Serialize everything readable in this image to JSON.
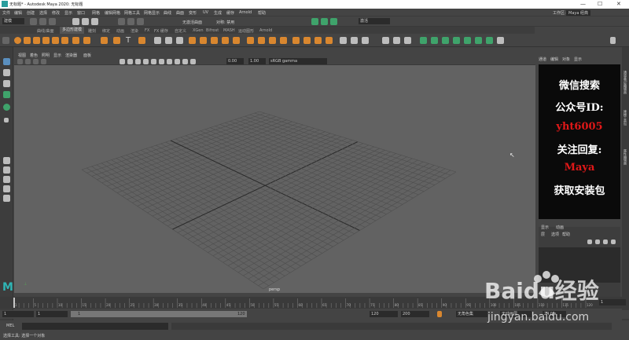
{
  "titlebar": {
    "title": "无标题* - Autodesk Maya 2020: 无标题",
    "minimize": "—",
    "maximize": "☐",
    "close": "✕"
  },
  "menubar": {
    "items": [
      "文件",
      "编辑",
      "创建",
      "选择",
      "修改",
      "显示",
      "窗口",
      "网格",
      "编辑网格",
      "网格工具",
      "网格显示",
      "曲线",
      "曲面",
      "变形",
      "UV",
      "生成",
      "缓存",
      "Arnold",
      "帮助"
    ],
    "workspace_label": "工作区:",
    "workspace_value": "Maya 经典"
  },
  "shelfrow": {
    "mode": "建模",
    "no_live": "无激活曲面",
    "symmetry": "对称: 禁用",
    "render_label": "激活"
  },
  "shelf_tabs": [
    "曲线/曲面",
    "多边形建模",
    "雕刻",
    "绑定",
    "动画",
    "渲染",
    "FX",
    "FX 缓存",
    "自定义",
    "XGen",
    "Bifrost",
    "MASH",
    "运动图形",
    "Arnold"
  ],
  "viewport": {
    "menu": [
      "视图",
      "着色",
      "照明",
      "显示",
      "渲染器",
      "面板"
    ],
    "exposure": "0.00",
    "gamma": "1.00",
    "colorspace": "sRGB gamma",
    "camera_label": "persp"
  },
  "right_panel": {
    "tabs": [
      "通道",
      "编辑",
      "对象",
      "显示"
    ],
    "side_tabs": [
      "通道盒/层编辑器",
      "建模工具包",
      "属性编辑器"
    ],
    "layer_tabs": [
      "显示",
      "动画"
    ],
    "layer_menu": [
      "层",
      "选项",
      "帮助"
    ]
  },
  "promo": {
    "line1": "微信搜索",
    "line2": "公众号ID:",
    "line3": "yht6005",
    "line4": "关注回复:",
    "line5": "Maya",
    "line6": "获取安装包"
  },
  "timeline": {
    "ticks": [
      "1",
      "5",
      "10",
      "15",
      "20",
      "25",
      "30",
      "35",
      "40",
      "45",
      "50",
      "55",
      "60",
      "65",
      "70",
      "75",
      "80",
      "85",
      "90",
      "95",
      "100",
      "105",
      "110",
      "115",
      "120"
    ],
    "current_frame": "1"
  },
  "range": {
    "start": "1",
    "start2": "1",
    "slider_start": "1",
    "slider_end": "120",
    "end": "120",
    "end2": "200",
    "char_set": "无角色集",
    "anim_layer": "无动画层",
    "fps": "24 fps"
  },
  "mel": {
    "label": "MEL"
  },
  "status": {
    "text": "选择工具: 选择一个对象"
  },
  "logo": {
    "letter": "M"
  },
  "watermark": {
    "brand": "Baidu经验",
    "url": "jingyan.baidu.com"
  }
}
